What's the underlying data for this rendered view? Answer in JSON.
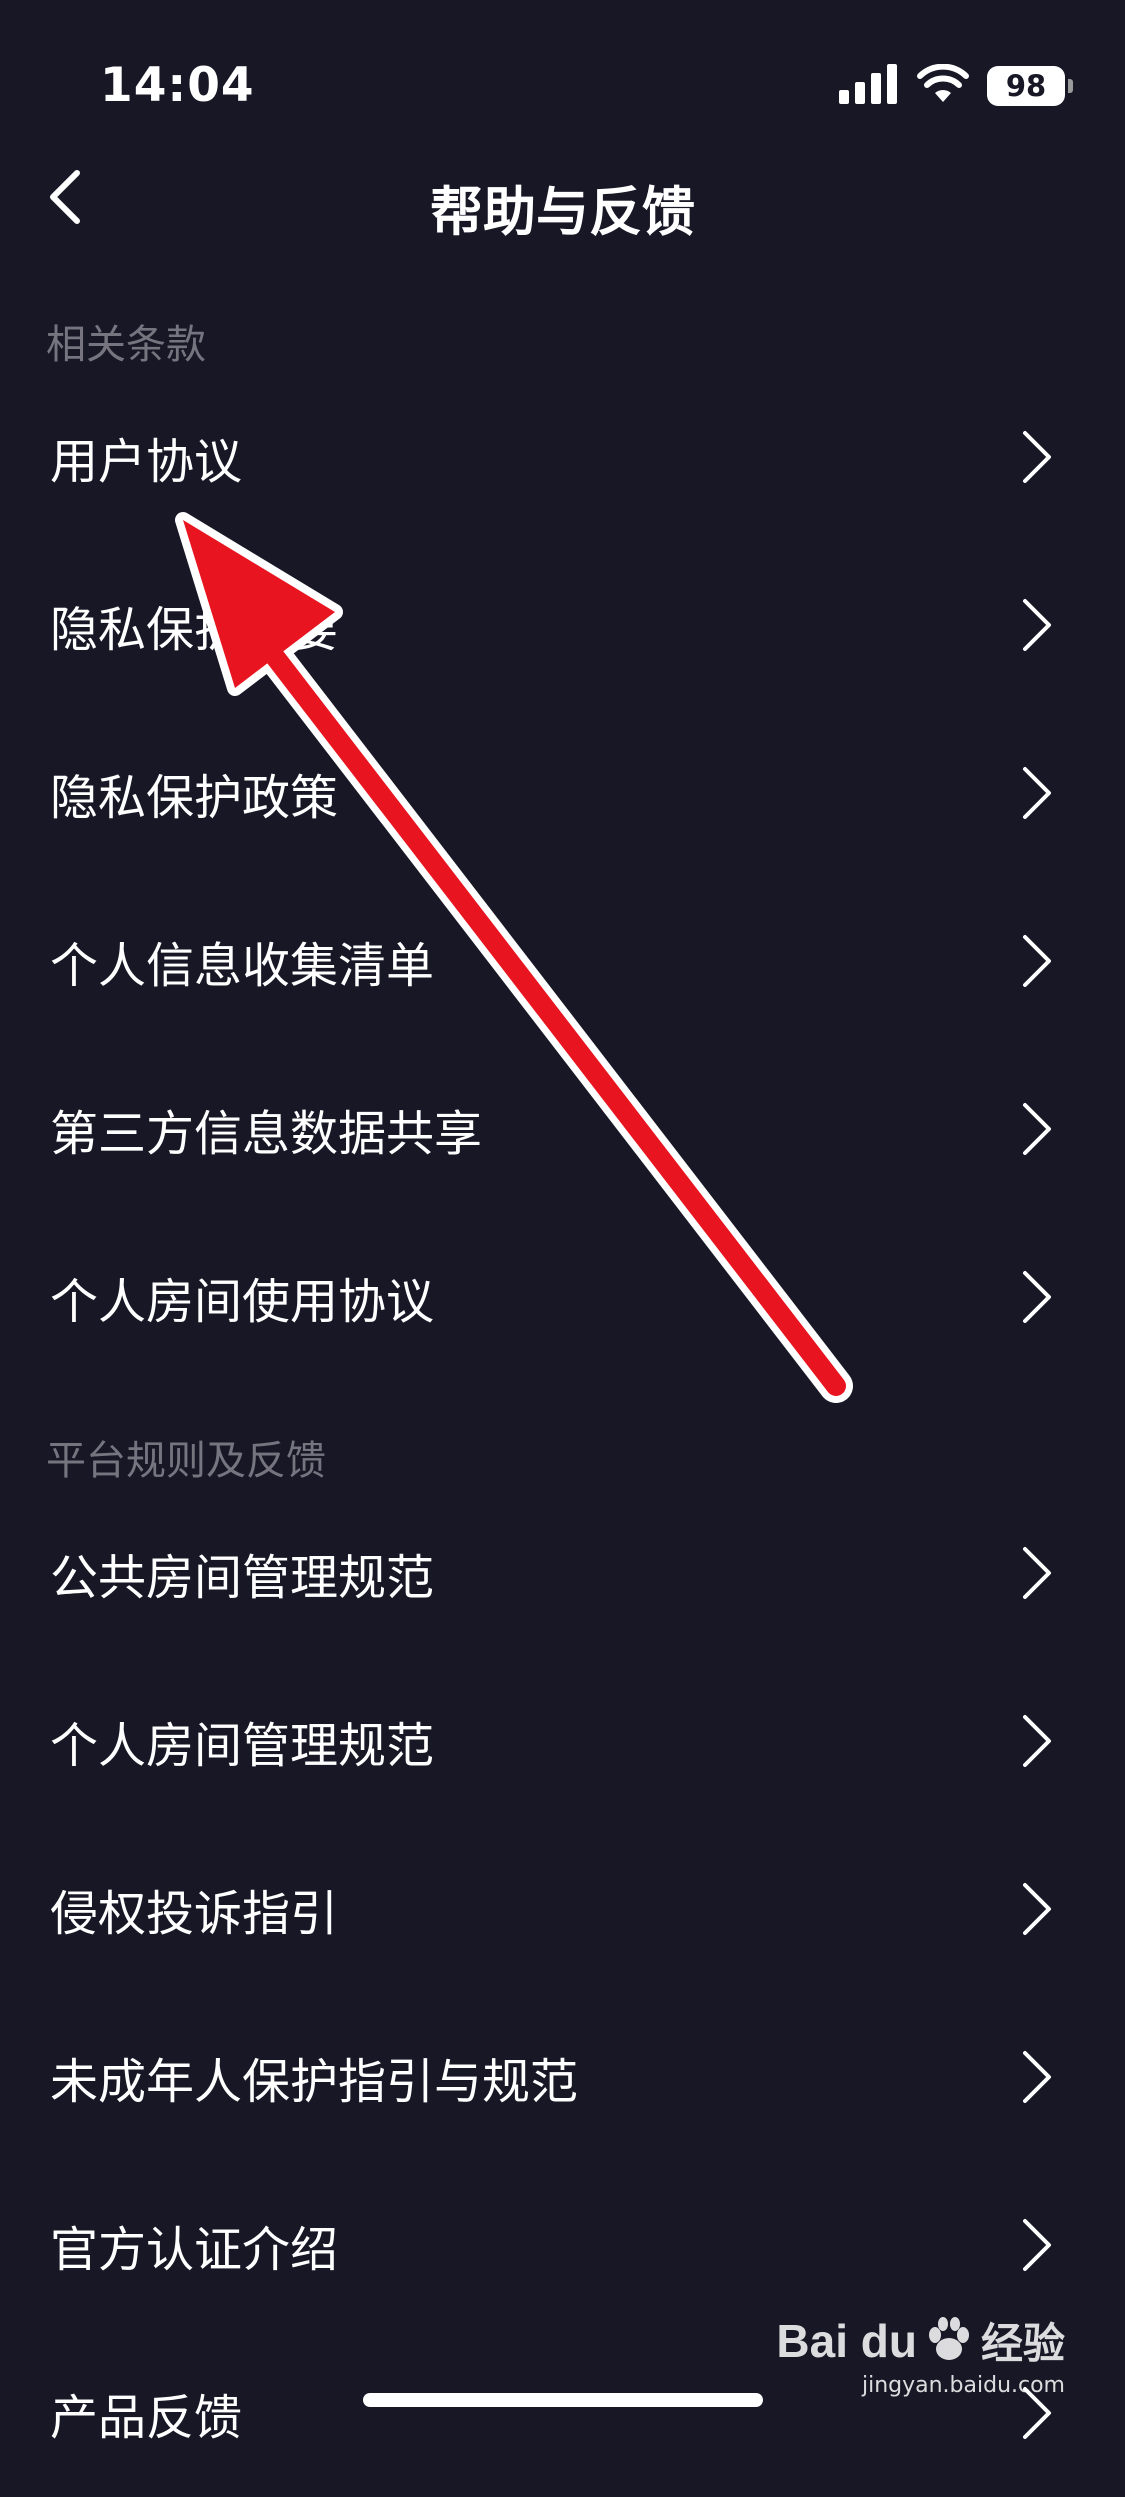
{
  "status_bar": {
    "time": "14:04",
    "battery": "98",
    "icons": [
      "signal-icon",
      "wifi-icon",
      "battery-icon"
    ]
  },
  "nav": {
    "title": "帮助与反馈",
    "back_icon": "chevron-left-icon"
  },
  "sections": [
    {
      "header": "相关条款",
      "items": [
        {
          "label": "用户协议"
        },
        {
          "label": "隐私保护摘要"
        },
        {
          "label": "隐私保护政策"
        },
        {
          "label": "个人信息收集清单"
        },
        {
          "label": "第三方信息数据共享"
        },
        {
          "label": "个人房间使用协议"
        }
      ]
    },
    {
      "header": "平台规则及反馈",
      "items": [
        {
          "label": "公共房间管理规范"
        },
        {
          "label": "个人房间管理规范"
        },
        {
          "label": "侵权投诉指引"
        },
        {
          "label": "未成年人保护指引与规范"
        },
        {
          "label": "官方认证介绍"
        },
        {
          "label": "产品反馈"
        }
      ]
    }
  ],
  "watermark": {
    "brand": "Bai du",
    "brand_suffix": "经验",
    "url": "jingyan.baidu.com"
  },
  "colors": {
    "background": "#181726",
    "section_header": "#75747f",
    "annotation_arrow": "#e8141f"
  }
}
